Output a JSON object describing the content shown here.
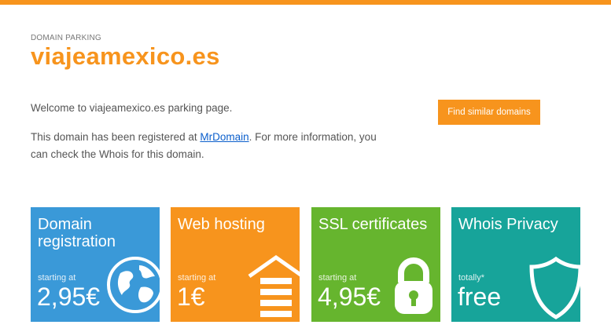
{
  "header": {
    "kicker": "DOMAIN PARKING",
    "domain": "viajeamexico.es"
  },
  "content": {
    "welcome": "Welcome to viajeamexico.es parking page.",
    "registered_prefix": "This domain has been registered at ",
    "registrar_link": "MrDomain",
    "registered_suffix": ". For more information, you can check the Whois for this domain."
  },
  "cta": {
    "find_similar_label": "Find similar domains"
  },
  "cards": [
    {
      "title": "Domain registration",
      "prefix": "starting at",
      "price": "2,95€",
      "icon": "globe-icon",
      "color": "#3a99d8"
    },
    {
      "title": "Web hosting",
      "prefix": "starting at",
      "price": "1€",
      "icon": "house-icon",
      "color": "#f7941d"
    },
    {
      "title": "SSL certificates",
      "prefix": "starting at",
      "price": "4,95€",
      "icon": "padlock-icon",
      "color": "#66b52e"
    },
    {
      "title": "Whois Privacy",
      "prefix": "totally*",
      "price": "free",
      "icon": "shield-icon",
      "color": "#17a49a"
    }
  ],
  "colors": {
    "accent": "#f7941d",
    "link": "#0b5fcc"
  }
}
